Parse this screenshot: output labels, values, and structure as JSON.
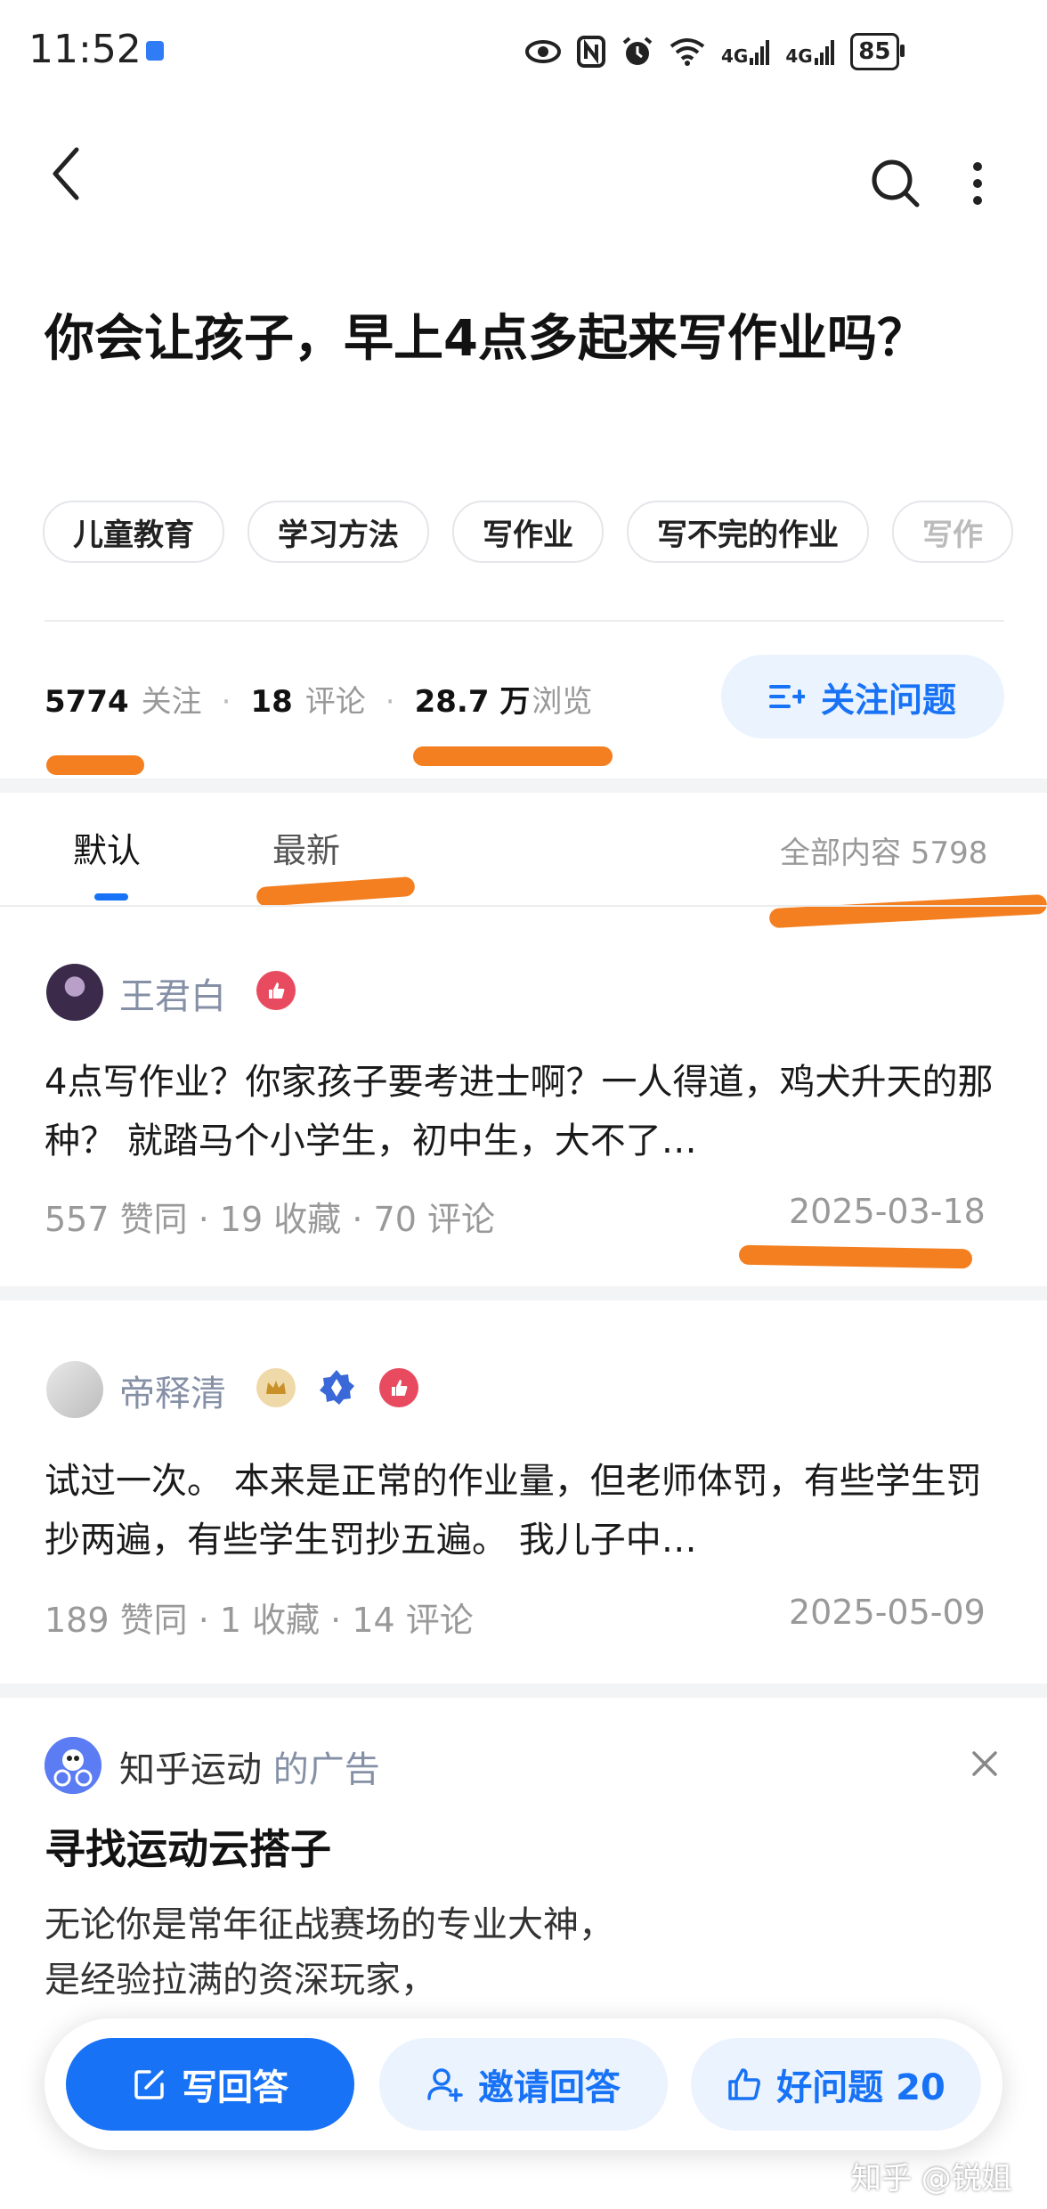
{
  "status_bar": {
    "time": "11:52",
    "net1": "4G",
    "net2": "4G",
    "battery": "85"
  },
  "header": {
    "back_icon": "chevron-left-icon",
    "search_icon": "search-icon",
    "more_icon": "more-vertical-icon"
  },
  "question": {
    "title": "你会让孩子，早上4点多起来写作业吗？",
    "tags": [
      "儿童教育",
      "学习方法",
      "写作业",
      "写不完的作业",
      "写作"
    ],
    "followers_count": "5774",
    "followers_label": "关注",
    "comments_count": "18",
    "comments_label": "评论",
    "views_count": "28.7 万",
    "views_label": "浏览",
    "follow_button": "关注问题"
  },
  "tabs": {
    "default": "默认",
    "latest": "最新",
    "all_content": "全部内容 5798"
  },
  "answers": [
    {
      "author": "王君白",
      "excerpt": "4点写作业？你家孩子要考进士啊？一人得道，鸡犬升天的那种？ 就踏马个小学生，初中生，大不了…",
      "meta": "557 赞同 · 19 收藏 · 70 评论",
      "date": "2025-03-18"
    },
    {
      "author": "帝释清",
      "excerpt": "试过一次。 本来是正常的作业量，但老师体罚，有些学生罚抄两遍，有些学生罚抄五遍。 我儿子中…",
      "meta": "189 赞同 · 1 收藏 · 14 评论",
      "date": "2025-05-09"
    }
  ],
  "ad": {
    "sponsor": "知乎运动",
    "sponsor_suffix": "的广告",
    "title": "寻找运动云搭子",
    "line1": "无论你是常年征战赛场的专业大神，",
    "line2": "是经验拉满的资深玩家，"
  },
  "action_bar": {
    "write": "写回答",
    "invite": "邀请回答",
    "good": "好问题 20"
  },
  "watermark": "知乎 @锐姐",
  "colors": {
    "brand_blue": "#1772f6",
    "light_blue": "#ebf3fe",
    "highlight_orange": "#f37f20"
  }
}
